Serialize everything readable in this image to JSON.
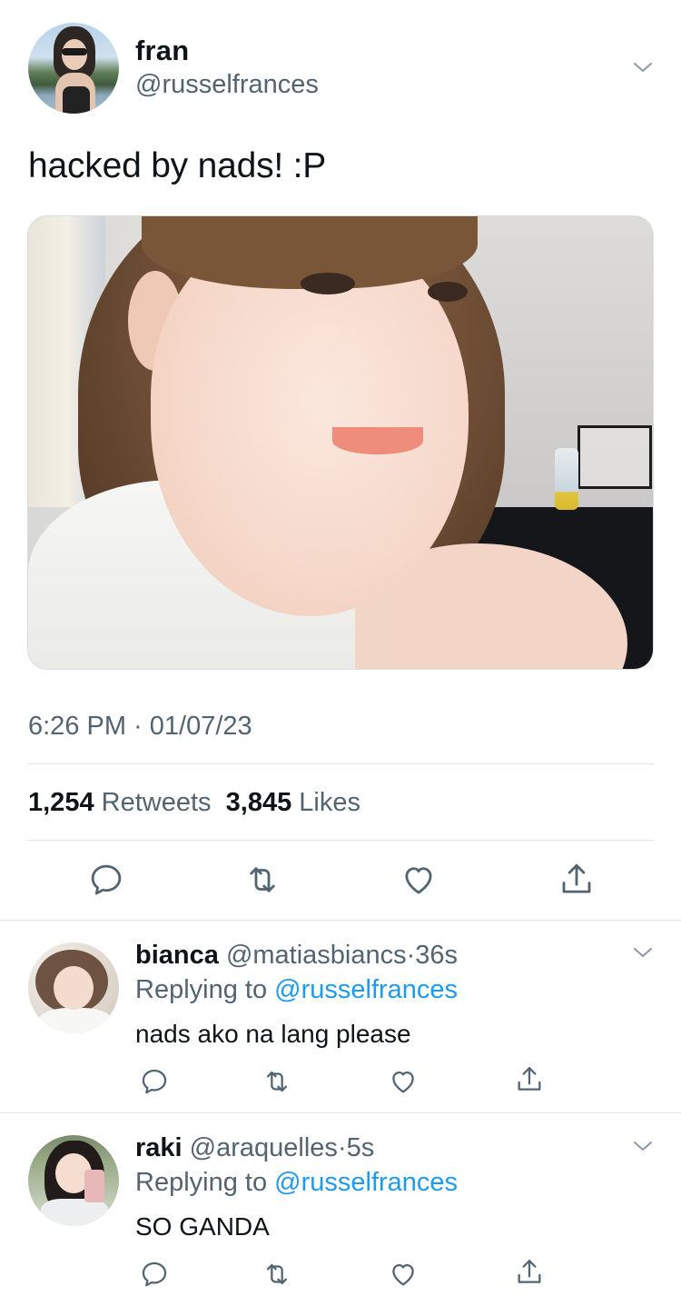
{
  "tweet": {
    "display_name": "fran",
    "handle": "@russelfrances",
    "text": "hacked by nads! :P",
    "time": "6:26 PM · 01/07/23",
    "retweets_count": "1,254",
    "retweets_label": "Retweets",
    "likes_count": "3,845",
    "likes_label": "Likes"
  },
  "replies": [
    {
      "display_name": "bianca",
      "handle": "@matiasbiancs",
      "time_sep": "·",
      "time": "36s",
      "replying_prefix": "Replying to",
      "replying_to": "@russelfrances",
      "text": "nads ako na lang please"
    },
    {
      "display_name": "raki",
      "handle": "@araquelles",
      "time_sep": "·",
      "time": "5s",
      "replying_prefix": "Replying to",
      "replying_to": "@russelfrances",
      "text": "SO GANDA"
    }
  ],
  "icons": {
    "reply": "reply-icon",
    "retweet": "retweet-icon",
    "like": "heart-icon",
    "share": "share-icon",
    "more": "chevron-down-icon"
  },
  "colors": {
    "text": "#0f1419",
    "secondary": "#536471",
    "link": "#1d9bf0",
    "divider": "#e1e5e8"
  }
}
